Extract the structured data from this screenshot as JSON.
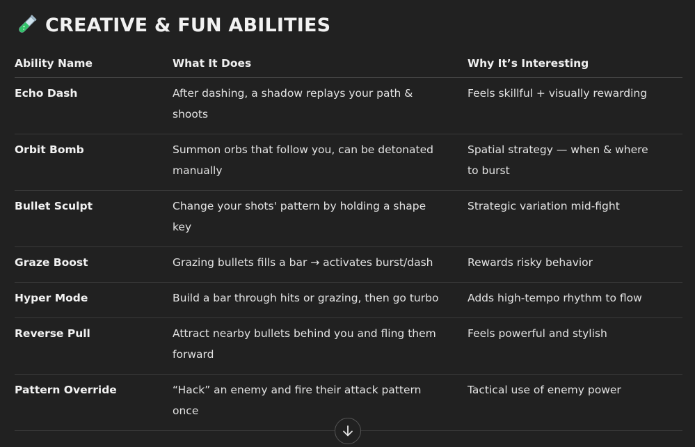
{
  "heading": {
    "icon": "test-tube-icon",
    "title": "CREATIVE & FUN ABILITIES"
  },
  "table": {
    "headers": [
      "Ability Name",
      "What It Does",
      "Why It’s Interesting"
    ],
    "rows": [
      {
        "name": "Echo Dash",
        "does": "After dashing, a shadow replays your path & shoots",
        "why": "Feels skillful + visually rewarding"
      },
      {
        "name": "Orbit Bomb",
        "does": "Summon orbs that follow you, can be detonated manually",
        "why": "Spatial strategy — when & where to burst"
      },
      {
        "name": "Bullet Sculpt",
        "does": "Change your shots' pattern by holding a shape key",
        "why": "Strategic variation mid-fight"
      },
      {
        "name": "Graze Boost",
        "does": "Grazing bullets fills a bar → activates burst/dash",
        "why": "Rewards risky behavior"
      },
      {
        "name": "Hyper Mode",
        "does": "Build a bar through hits or grazing, then go turbo",
        "why": "Adds high-tempo rhythm to flow"
      },
      {
        "name": "Reverse Pull",
        "does": "Attract nearby bullets behind you and fling them forward",
        "why": "Feels powerful and stylish"
      },
      {
        "name": "Pattern Override",
        "does": "“Hack” an enemy and fire their attack pattern once",
        "why": "Tactical use of enemy power"
      }
    ]
  },
  "scroll_button": {
    "icon": "arrow-down-icon"
  },
  "colors": {
    "background": "#212121",
    "text": "#ececec",
    "divider": "#3a3a3a"
  }
}
